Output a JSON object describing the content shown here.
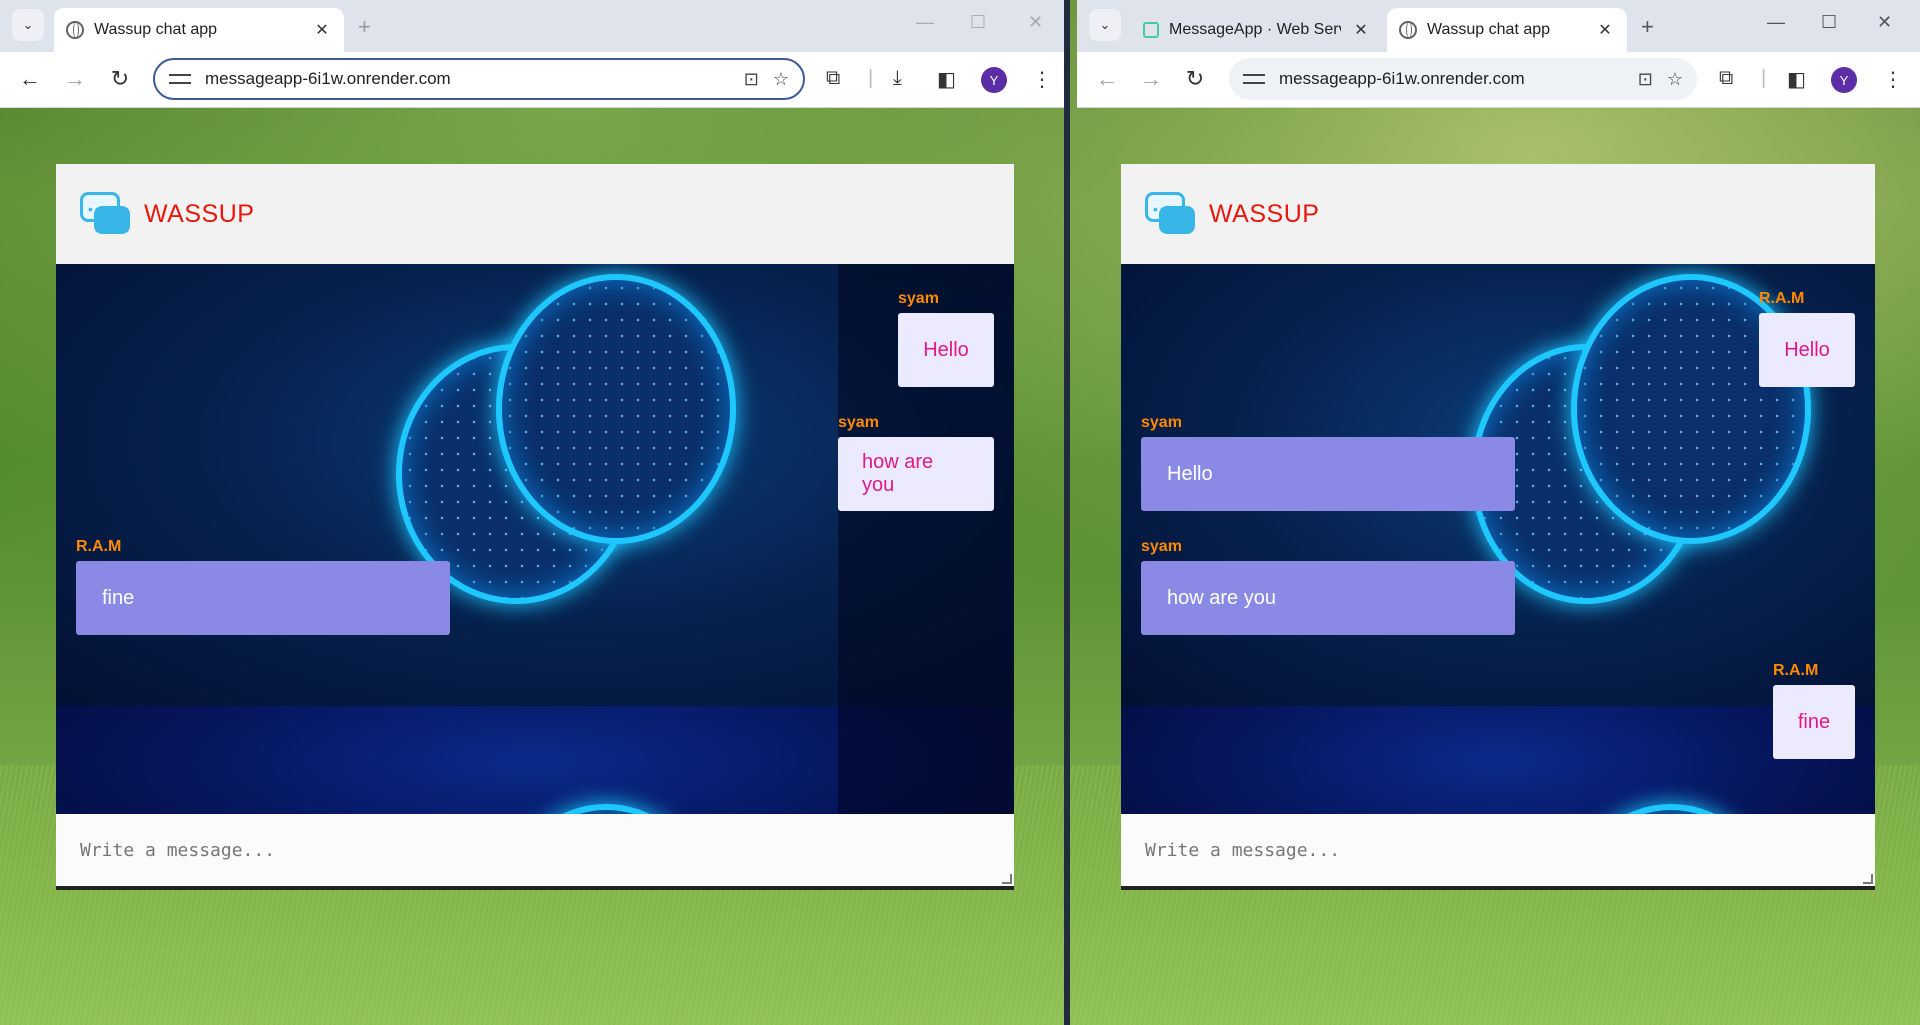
{
  "left_window": {
    "tabs": [
      {
        "title": "Wassup chat app",
        "close": "✕",
        "active": true
      }
    ],
    "new_tab": "+",
    "url": "messageapp-6i1w.onrender.com",
    "avatar": "Y",
    "app": {
      "brand": "WASSUP",
      "messages": [
        {
          "sender": "syam",
          "text": "Hello",
          "side": "mine"
        },
        {
          "sender": "syam",
          "text": "how are you",
          "side": "mine"
        },
        {
          "sender": "R.A.M",
          "text": "fine",
          "side": "theirs"
        }
      ],
      "composer_placeholder": "Write a message..."
    }
  },
  "right_window": {
    "tabs": [
      {
        "title": "MessageApp · Web Servi",
        "close": "✕",
        "active": false
      },
      {
        "title": "Wassup chat app",
        "close": "✕",
        "active": true
      }
    ],
    "new_tab": "+",
    "url": "messageapp-6i1w.onrender.com",
    "avatar": "Y",
    "app": {
      "brand": "WASSUP",
      "messages": [
        {
          "sender": "R.A.M",
          "text": "Hello",
          "side": "mine"
        },
        {
          "sender": "syam",
          "text": "Hello",
          "side": "theirs"
        },
        {
          "sender": "syam",
          "text": "how are you",
          "side": "theirs"
        },
        {
          "sender": "R.A.M",
          "text": "fine",
          "side": "mine"
        }
      ],
      "composer_placeholder": "Write a message..."
    }
  },
  "colors": {
    "brand": "#e8180c",
    "sender": "#ff8a00",
    "mine_bubble_bg": "#eceaff",
    "mine_bubble_text": "#e2188a",
    "theirs_bubble_bg": "#8a8ae6",
    "theirs_bubble_text": "#ffffff"
  },
  "icons": {
    "tab_menu": "chevron-down-icon",
    "back": "arrow-left-icon",
    "forward": "arrow-right-icon",
    "reload": "reload-icon",
    "site_info": "tune-icon",
    "translate": "translate-icon",
    "bookmark": "star-icon",
    "extensions": "puzzle-icon",
    "download": "download-icon",
    "side_panel": "side-panel-icon",
    "menu": "kebab-menu-icon",
    "logo": "chat-bubbles-icon"
  }
}
